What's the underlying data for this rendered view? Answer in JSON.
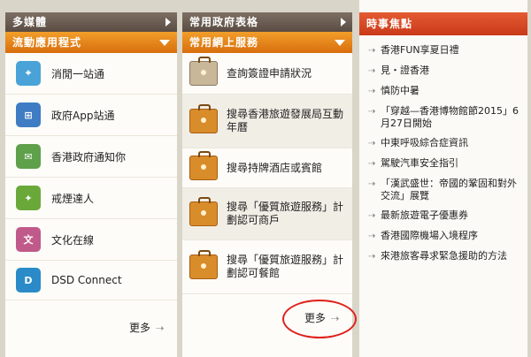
{
  "col1": {
    "top_header": "多媒體",
    "sub_header": "流動應用程式",
    "items": [
      {
        "label": "消閒一站通",
        "icon": "map-app-icon",
        "color": "#4aa3d8"
      },
      {
        "label": "政府App站通",
        "icon": "gov-app-icon",
        "color": "#3f7cc4"
      },
      {
        "label": "香港政府通知你",
        "icon": "gov-notify-icon",
        "color": "#5fa04a"
      },
      {
        "label": "戒煙達人",
        "icon": "quit-smoking-icon",
        "color": "#6aa83a"
      },
      {
        "label": "文化在線",
        "icon": "culture-icon",
        "color": "#c05a8a"
      },
      {
        "label": "DSD Connect",
        "icon": "dsd-icon",
        "color": "#2a8bc8"
      }
    ],
    "more": "更多"
  },
  "col2": {
    "top_header": "常用政府表格",
    "sub_header": "常用網上服務",
    "items": [
      {
        "label": "查詢簽證申請狀況",
        "icon": "visa-stamp-icon"
      },
      {
        "label": "搜尋香港旅遊發展局互動年曆",
        "icon": "briefcase-icon"
      },
      {
        "label": "搜尋持牌酒店或賓館",
        "icon": "briefcase-icon"
      },
      {
        "label": "搜尋「優質旅遊服務」計劃認可商戶",
        "icon": "briefcase-icon"
      },
      {
        "label": "搜尋「優質旅遊服務」計劃認可餐館",
        "icon": "briefcase-icon"
      }
    ],
    "more": "更多"
  },
  "col3": {
    "header": "時事焦點",
    "items": [
      "香港FUN享夏日禮",
      "見・證香港",
      "慎防中暑",
      "「穿越—香港博物館節2015」6月27日開始",
      "中東呼吸綜合症資訊",
      "駕駛汽車安全指引",
      "「漢武盛世：帝國的鞏固和對外交流」展覽",
      "最新旅遊電子優惠券",
      "香港國際機場入境程序",
      "來港旅客尋求緊急援助的方法"
    ]
  }
}
